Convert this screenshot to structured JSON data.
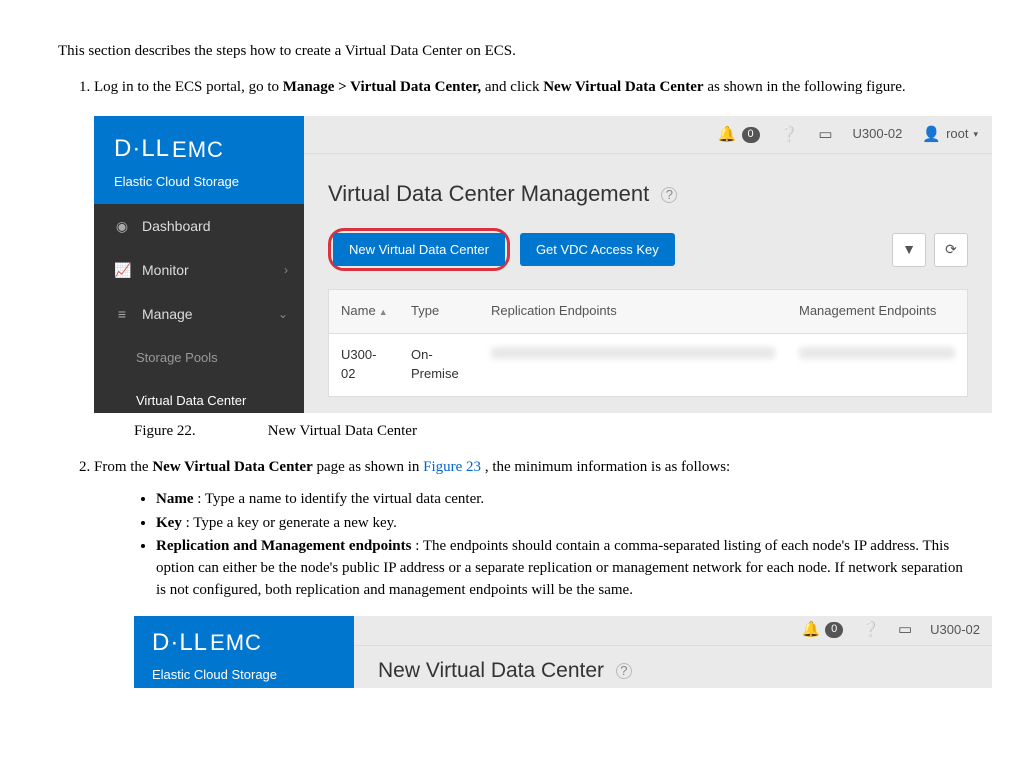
{
  "intro": "This section describes the steps how to create a Virtual Data Center on ECS.",
  "step1": {
    "pre": "Log in to the ECS portal, go to ",
    "b1": "Manage > Virtual Data Center,",
    "mid": " and click ",
    "b2": "New Virtual Data Center",
    "post": " as shown in the following figure."
  },
  "shot1": {
    "brand_top": "D·LL",
    "brand_emc": "EMC",
    "brand_sub": "Elastic Cloud Storage",
    "nav": {
      "dashboard": "Dashboard",
      "monitor": "Monitor",
      "manage": "Manage",
      "storage_pools": "Storage Pools",
      "vdc": "Virtual Data Center"
    },
    "topbar": {
      "alert_count": "0",
      "node": "U300-02",
      "user": "root"
    },
    "page_title": "Virtual Data Center Management",
    "btn_new": "New Virtual Data Center",
    "btn_key": "Get VDC Access Key",
    "table": {
      "h_name": "Name",
      "h_type": "Type",
      "h_rep": "Replication Endpoints",
      "h_mgt": "Management Endpoints",
      "row": {
        "name": "U300-02",
        "type": "On-Premise"
      }
    }
  },
  "caption": {
    "label": "Figure 22.",
    "text": "New Virtual Data Center"
  },
  "step2": {
    "pre": "From the ",
    "b1": "New Virtual Data Center",
    "mid": " page as shown in ",
    "link": "Figure 23",
    "post": " , the minimum information is as follows:"
  },
  "bullets": {
    "name_b": "Name",
    "name_t": " : Type a name to identify the virtual data center.",
    "key_b": "Key",
    "key_t": " : Type a key or generate a new key.",
    "rep_b": "Replication and Management endpoints",
    "rep_t": " : The endpoints should contain a comma-separated listing of each node's IP address. This option can either be the node's public IP address or a separate replication or management network for each node. If network separation is not configured, both replication and management endpoints will be the same."
  },
  "shot2": {
    "brand_top": "D·LL",
    "brand_emc": "EMC",
    "brand_sub": "Elastic Cloud Storage",
    "alert_count": "0",
    "node": "U300-02",
    "title": "New Virtual Data Center"
  }
}
